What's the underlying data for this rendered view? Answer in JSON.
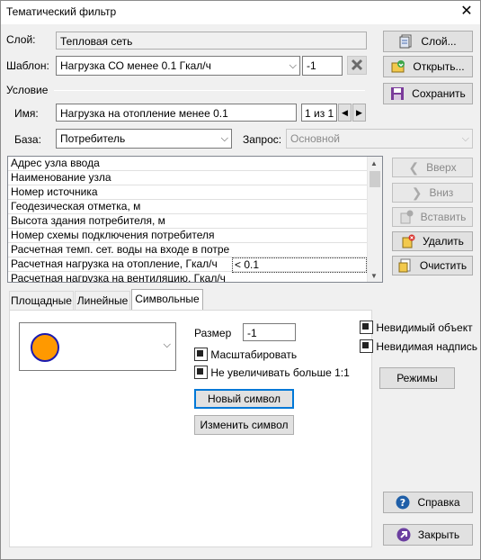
{
  "window": {
    "title": "Тематический фильтр",
    "close_glyph": "✕"
  },
  "layer": {
    "label": "Слой:",
    "value": "Тепловая сеть",
    "button": "Слой..."
  },
  "template": {
    "label": "Шаблон:",
    "value": "Нагрузка СО менее 0.1 Гкал/ч",
    "index": "-1",
    "open_button": "Открыть...",
    "save_button": "Сохранить"
  },
  "condition": {
    "section_label": "Условие",
    "name_label": "Имя:",
    "name_value": "Нагрузка на отопление менее 0.1",
    "counter": "1 из 1",
    "base_label": "База:",
    "base_value": "Потребитель",
    "query_label": "Запрос:",
    "query_value": "Основной"
  },
  "grid": {
    "rows": [
      {
        "field": "Адрес узла ввода",
        "value": ""
      },
      {
        "field": "Наименование узла",
        "value": ""
      },
      {
        "field": "Номер источника",
        "value": ""
      },
      {
        "field": "Геодезическая отметка, м",
        "value": ""
      },
      {
        "field": "Высота здания потребителя, м",
        "value": ""
      },
      {
        "field": "Номер схемы подключения потребителя",
        "value": ""
      },
      {
        "field": "Расчетная темп. сет. воды на входе в потреб…",
        "value": ""
      },
      {
        "field": "Расчетная нагрузка на отопление, Гкал/ч",
        "value": "< 0.1",
        "selected": true
      },
      {
        "field": "Расчетная нагрузка на вентиляцию, Гкал/ч",
        "value": ""
      }
    ]
  },
  "side_buttons": {
    "up": "Вверх",
    "down": "Вниз",
    "insert": "Вставить",
    "delete": "Удалить",
    "clear": "Очистить"
  },
  "tabs": [
    "Площадные",
    "Линейные",
    "Символьные"
  ],
  "active_tab": 2,
  "symbol": {
    "fill_color": "#ff9900",
    "stroke_color": "#1a1ab0",
    "size_label": "Размер",
    "size_value": "-1",
    "scale_label": "Масштабировать",
    "scale_checked": true,
    "no_enlarge_label": "Не увеличивать больше 1:1",
    "no_enlarge_checked": true,
    "new_button": "Новый символ",
    "edit_button": "Изменить символ"
  },
  "right_options": {
    "invisible_object": "Невидимый объект",
    "invisible_label": "Невидимая надпись",
    "modes_button": "Режимы"
  },
  "footer": {
    "help_button": "Справка",
    "close_button": "Закрыть"
  }
}
